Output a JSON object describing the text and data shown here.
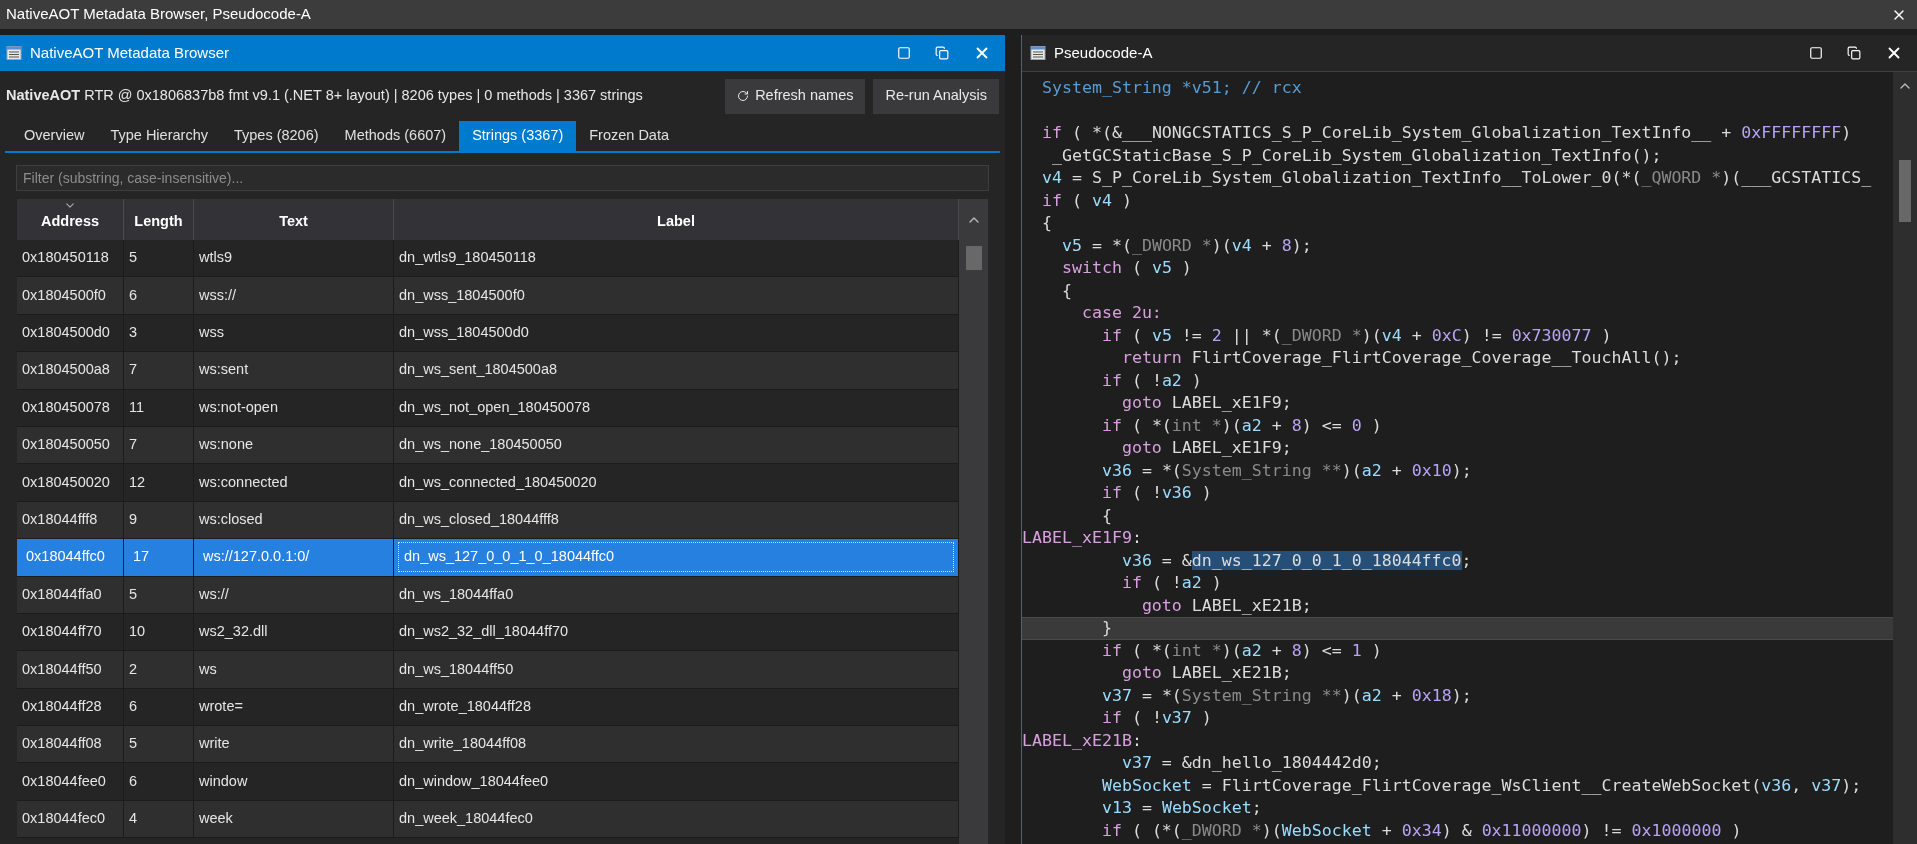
{
  "window": {
    "title": "NativeAOT Metadata Browser, Pseudocode-A"
  },
  "metadata_panel": {
    "title": "NativeAOT Metadata Browser",
    "summary": "**NativeAOT** RTR @ 0x1806837b8 fmt v9.1 (.NET 8+ layout) | 8206 types | 0 methods | 3367 strings",
    "buttons": [
      {
        "label": "Refresh names",
        "kind": "refresh"
      },
      {
        "label": "Re-run Analysis",
        "kind": "plain"
      }
    ],
    "tabs": [
      {
        "label": "Overview",
        "selected": false
      },
      {
        "label": "Type Hierarchy",
        "selected": false
      },
      {
        "label": "Types (8206)",
        "selected": false
      },
      {
        "label": "Methods (6607)",
        "selected": false
      },
      {
        "label": "Strings (3367)",
        "selected": true
      },
      {
        "label": "Frozen Data",
        "selected": false
      }
    ],
    "filter": {
      "placeholder": "Filter (substring, case-insensitive)..."
    },
    "table": {
      "columns": [
        {
          "label": "Address",
          "sorted": true
        },
        {
          "label": "Length",
          "sorted": false
        },
        {
          "label": "Text",
          "sorted": false
        },
        {
          "label": "Label",
          "sorted": false
        }
      ],
      "rows": [
        {
          "address": "0x180450118",
          "length": "5",
          "text": "wtls9",
          "label": "dn_wtls9_180450118",
          "selected": false
        },
        {
          "address": "0x1804500f0",
          "length": "6",
          "text": "wss://",
          "label": "dn_wss_1804500f0",
          "selected": false
        },
        {
          "address": "0x1804500d0",
          "length": "3",
          "text": "wss",
          "label": "dn_wss_1804500d0",
          "selected": false
        },
        {
          "address": "0x1804500a8",
          "length": "7",
          "text": "ws:sent",
          "label": "dn_ws_sent_1804500a8",
          "selected": false
        },
        {
          "address": "0x180450078",
          "length": "11",
          "text": "ws:not-open",
          "label": "dn_ws_not_open_180450078",
          "selected": false
        },
        {
          "address": "0x180450050",
          "length": "7",
          "text": "ws:none",
          "label": "dn_ws_none_180450050",
          "selected": false
        },
        {
          "address": "0x180450020",
          "length": "12",
          "text": "ws:connected",
          "label": "dn_ws_connected_180450020",
          "selected": false
        },
        {
          "address": "0x18044fff8",
          "length": "9",
          "text": "ws:closed",
          "label": "dn_ws_closed_18044fff8",
          "selected": false
        },
        {
          "address": "0x18044ffc0",
          "length": "17",
          "text": "ws://127.0.0.1:0/",
          "label": "dn_ws_127_0_0_1_0_18044ffc0",
          "selected": true
        },
        {
          "address": "0x18044ffa0",
          "length": "5",
          "text": "ws://",
          "label": "dn_ws_18044ffa0",
          "selected": false
        },
        {
          "address": "0x18044ff70",
          "length": "10",
          "text": "ws2_32.dll",
          "label": "dn_ws2_32_dll_18044ff70",
          "selected": false
        },
        {
          "address": "0x18044ff50",
          "length": "2",
          "text": "ws",
          "label": "dn_ws_18044ff50",
          "selected": false
        },
        {
          "address": "0x18044ff28",
          "length": "6",
          "text": "wrote=",
          "label": "dn_wrote_18044ff28",
          "selected": false
        },
        {
          "address": "0x18044ff08",
          "length": "5",
          "text": "write",
          "label": "dn_write_18044ff08",
          "selected": false
        },
        {
          "address": "0x18044fee0",
          "length": "6",
          "text": "window",
          "label": "dn_window_18044fee0",
          "selected": false
        },
        {
          "address": "0x18044fec0",
          "length": "4",
          "text": "week",
          "label": "dn_week_18044fec0",
          "selected": false
        }
      ]
    }
  },
  "pseudocode_panel": {
    "title": "Pseudocode-A",
    "lines": [
      {
        "current": false,
        "segments": [
          {
            "kind": "decl",
            "text": "  System_String *v51; // rcx"
          }
        ]
      },
      {
        "current": false
      },
      {
        "current": false,
        "segments": [
          {
            "kind": "kw",
            "text": "  if"
          },
          {
            "kind": "plain",
            "text": " ( *(&___NONGCSTATICS_S_P_CoreLib_System_Globalization_TextInfo__ + "
          },
          {
            "kind": "num",
            "text": "0xFFFFFFFF"
          },
          {
            "kind": "plain",
            "text": ")"
          }
        ]
      },
      {
        "current": false,
        "segments": [
          {
            "kind": "plain",
            "text": "   _GetGCStaticBase_S_P_CoreLib_System_Globalization_TextInfo();"
          }
        ]
      },
      {
        "current": false,
        "segments": [
          {
            "kind": "var",
            "text": "  v4"
          },
          {
            "kind": "plain",
            "text": " = S_P_CoreLib_System_Globalization_TextInfo__ToLower_0(*("
          },
          {
            "kind": "type",
            "text": "_QWORD *"
          },
          {
            "kind": "plain",
            "text": ")(___GCSTATICS_"
          }
        ]
      },
      {
        "current": false,
        "segments": [
          {
            "kind": "kw",
            "text": "  if"
          },
          {
            "kind": "plain",
            "text": " ( "
          },
          {
            "kind": "var",
            "text": "v4"
          },
          {
            "kind": "plain",
            "text": " )"
          }
        ]
      },
      {
        "current": false,
        "segments": [
          {
            "kind": "plain",
            "text": "  {"
          }
        ]
      },
      {
        "current": false,
        "segments": [
          {
            "kind": "var",
            "text": "    v5"
          },
          {
            "kind": "plain",
            "text": " = *("
          },
          {
            "kind": "type",
            "text": "_DWORD *"
          },
          {
            "kind": "plain",
            "text": ")("
          },
          {
            "kind": "var",
            "text": "v4"
          },
          {
            "kind": "plain",
            "text": " + "
          },
          {
            "kind": "num",
            "text": "8"
          },
          {
            "kind": "plain",
            "text": ");"
          }
        ]
      },
      {
        "current": false,
        "segments": [
          {
            "kind": "kw",
            "text": "    switch"
          },
          {
            "kind": "plain",
            "text": " ( "
          },
          {
            "kind": "var",
            "text": "v5"
          },
          {
            "kind": "plain",
            "text": " )"
          }
        ]
      },
      {
        "current": false,
        "segments": [
          {
            "kind": "plain",
            "text": "    {"
          }
        ]
      },
      {
        "current": false,
        "segments": [
          {
            "kind": "kw",
            "text": "      case 2u:"
          }
        ]
      },
      {
        "current": false,
        "segments": [
          {
            "kind": "kw",
            "text": "        if"
          },
          {
            "kind": "plain",
            "text": " ( "
          },
          {
            "kind": "var",
            "text": "v5"
          },
          {
            "kind": "plain",
            "text": " != "
          },
          {
            "kind": "num",
            "text": "2"
          },
          {
            "kind": "plain",
            "text": " || *("
          },
          {
            "kind": "type",
            "text": "_DWORD *"
          },
          {
            "kind": "plain",
            "text": ")("
          },
          {
            "kind": "var",
            "text": "v4"
          },
          {
            "kind": "plain",
            "text": " + "
          },
          {
            "kind": "num",
            "text": "0xC"
          },
          {
            "kind": "plain",
            "text": ") != "
          },
          {
            "kind": "num",
            "text": "0x730077"
          },
          {
            "kind": "plain",
            "text": " )"
          }
        ]
      },
      {
        "current": false,
        "segments": [
          {
            "kind": "kw",
            "text": "          return"
          },
          {
            "kind": "plain",
            "text": " FlirtCoverage_FlirtCoverage_Coverage__TouchAll();"
          }
        ]
      },
      {
        "current": false,
        "segments": [
          {
            "kind": "kw",
            "text": "        if"
          },
          {
            "kind": "plain",
            "text": " ( !"
          },
          {
            "kind": "var",
            "text": "a2"
          },
          {
            "kind": "plain",
            "text": " )"
          }
        ]
      },
      {
        "current": false,
        "segments": [
          {
            "kind": "kw",
            "text": "          goto"
          },
          {
            "kind": "plain",
            "text": " LABEL_xE1F9;"
          }
        ]
      },
      {
        "current": false,
        "segments": [
          {
            "kind": "kw",
            "text": "        if"
          },
          {
            "kind": "plain",
            "text": " ( *("
          },
          {
            "kind": "type",
            "text": "int *"
          },
          {
            "kind": "plain",
            "text": ")("
          },
          {
            "kind": "var",
            "text": "a2"
          },
          {
            "kind": "plain",
            "text": " + "
          },
          {
            "kind": "num",
            "text": "8"
          },
          {
            "kind": "plain",
            "text": ") <= "
          },
          {
            "kind": "num",
            "text": "0"
          },
          {
            "kind": "plain",
            "text": " )"
          }
        ]
      },
      {
        "current": false,
        "segments": [
          {
            "kind": "kw",
            "text": "          goto"
          },
          {
            "kind": "plain",
            "text": " LABEL_xE1F9;"
          }
        ]
      },
      {
        "current": false,
        "segments": [
          {
            "kind": "var",
            "text": "        v36"
          },
          {
            "kind": "plain",
            "text": " = *("
          },
          {
            "kind": "type",
            "text": "System_String **"
          },
          {
            "kind": "plain",
            "text": ")("
          },
          {
            "kind": "var",
            "text": "a2"
          },
          {
            "kind": "plain",
            "text": " + "
          },
          {
            "kind": "num",
            "text": "0x10"
          },
          {
            "kind": "plain",
            "text": ");"
          }
        ]
      },
      {
        "current": false,
        "segments": [
          {
            "kind": "kw",
            "text": "        if"
          },
          {
            "kind": "plain",
            "text": " ( !"
          },
          {
            "kind": "var",
            "text": "v36"
          },
          {
            "kind": "plain",
            "text": " )"
          }
        ]
      },
      {
        "current": false,
        "segments": [
          {
            "kind": "plain",
            "text": "        {"
          }
        ]
      },
      {
        "current": false,
        "segments": [
          {
            "kind": "label",
            "text": "LABEL_xE1F9"
          },
          {
            "kind": "plain",
            "text": ":"
          }
        ]
      },
      {
        "current": false,
        "segments": [
          {
            "kind": "var",
            "text": "          v36"
          },
          {
            "kind": "plain",
            "text": " = &"
          },
          {
            "kind": "selected",
            "text": "dn_ws_127_0_0_1_0_18044ffc0"
          },
          {
            "kind": "plain",
            "text": ";"
          }
        ]
      },
      {
        "current": false,
        "segments": [
          {
            "kind": "kw",
            "text": "          if"
          },
          {
            "kind": "plain",
            "text": " ( !"
          },
          {
            "kind": "var",
            "text": "a2"
          },
          {
            "kind": "plain",
            "text": " )"
          }
        ]
      },
      {
        "current": false,
        "segments": [
          {
            "kind": "kw",
            "text": "            goto"
          },
          {
            "kind": "plain",
            "text": " LABEL_xE21B;"
          }
        ]
      },
      {
        "current": true,
        "segments": [
          {
            "kind": "plain",
            "text": "        }"
          }
        ]
      },
      {
        "current": false,
        "segments": [
          {
            "kind": "kw",
            "text": "        if"
          },
          {
            "kind": "plain",
            "text": " ( *("
          },
          {
            "kind": "type",
            "text": "int *"
          },
          {
            "kind": "plain",
            "text": ")("
          },
          {
            "kind": "var",
            "text": "a2"
          },
          {
            "kind": "plain",
            "text": " + "
          },
          {
            "kind": "num",
            "text": "8"
          },
          {
            "kind": "plain",
            "text": ") <= "
          },
          {
            "kind": "num",
            "text": "1"
          },
          {
            "kind": "plain",
            "text": " )"
          }
        ]
      },
      {
        "current": false,
        "segments": [
          {
            "kind": "kw",
            "text": "          goto"
          },
          {
            "kind": "plain",
            "text": " LABEL_xE21B;"
          }
        ]
      },
      {
        "current": false,
        "segments": [
          {
            "kind": "var",
            "text": "        v37"
          },
          {
            "kind": "plain",
            "text": " = *("
          },
          {
            "kind": "type",
            "text": "System_String **"
          },
          {
            "kind": "plain",
            "text": ")("
          },
          {
            "kind": "var",
            "text": "a2"
          },
          {
            "kind": "plain",
            "text": " + "
          },
          {
            "kind": "num",
            "text": "0x18"
          },
          {
            "kind": "plain",
            "text": ");"
          }
        ]
      },
      {
        "current": false,
        "segments": [
          {
            "kind": "kw",
            "text": "        if"
          },
          {
            "kind": "plain",
            "text": " ( !"
          },
          {
            "kind": "var",
            "text": "v37"
          },
          {
            "kind": "plain",
            "text": " )"
          }
        ]
      },
      {
        "current": false,
        "segments": [
          {
            "kind": "label",
            "text": "LABEL_xE21B"
          },
          {
            "kind": "plain",
            "text": ":"
          }
        ]
      },
      {
        "current": false,
        "segments": [
          {
            "kind": "var",
            "text": "          v37"
          },
          {
            "kind": "plain",
            "text": " = &dn_hello_1804442d0;"
          }
        ]
      },
      {
        "current": false,
        "segments": [
          {
            "kind": "var",
            "text": "        WebSocket"
          },
          {
            "kind": "plain",
            "text": " = FlirtCoverage_FlirtCoverage_WsClient__CreateWebSocket("
          },
          {
            "kind": "var",
            "text": "v36"
          },
          {
            "kind": "plain",
            "text": ", "
          },
          {
            "kind": "var",
            "text": "v37"
          },
          {
            "kind": "plain",
            "text": ");"
          }
        ]
      },
      {
        "current": false,
        "segments": [
          {
            "kind": "var",
            "text": "        v13"
          },
          {
            "kind": "plain",
            "text": " = "
          },
          {
            "kind": "var",
            "text": "WebSocket"
          },
          {
            "kind": "plain",
            "text": ";"
          }
        ]
      },
      {
        "current": false,
        "segments": [
          {
            "kind": "kw",
            "text": "        if"
          },
          {
            "kind": "plain",
            "text": " ( (*("
          },
          {
            "kind": "type",
            "text": "_DWORD *"
          },
          {
            "kind": "plain",
            "text": ")("
          },
          {
            "kind": "var",
            "text": "WebSocket"
          },
          {
            "kind": "plain",
            "text": " + "
          },
          {
            "kind": "num",
            "text": "0x34"
          },
          {
            "kind": "plain",
            "text": ") & "
          },
          {
            "kind": "num",
            "text": "0x11000000"
          },
          {
            "kind": "plain",
            "text": ") != "
          },
          {
            "kind": "num",
            "text": "0x1000000"
          },
          {
            "kind": "plain",
            "text": " )"
          }
        ]
      }
    ]
  }
}
